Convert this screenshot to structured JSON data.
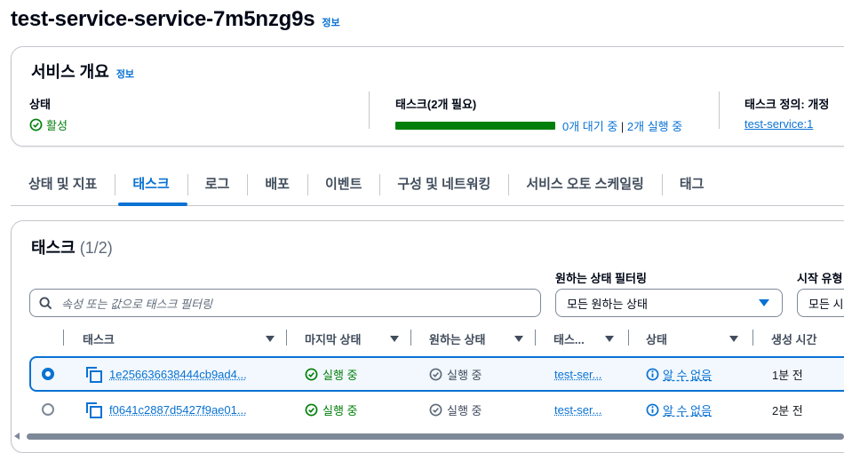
{
  "page": {
    "title": "test-service-service-7m5nzg9s",
    "info": "정보"
  },
  "overview": {
    "title": "서비스 개요",
    "info": "정보",
    "status_label": "상태",
    "status_value": "활성",
    "tasks_label": "태스크(2개 필요)",
    "pending": "0개 대기 중",
    "separator": " | ",
    "running": "2개 실행 중",
    "progress_fraction": 1.0,
    "taskdef_label": "태스크 정의: 개정",
    "taskdef_value": "test-service:1"
  },
  "tabs": [
    "상태 및 지표",
    "태스크",
    "로그",
    "배포",
    "이벤트",
    "구성 및 네트워킹",
    "서비스 오토 스케일링",
    "태그"
  ],
  "active_tab": "태스크",
  "tasks": {
    "title": "태스크",
    "count": "(1/2)",
    "desired_filter_label": "원하는 상태 필터링",
    "launch_type_label": "시작 유형",
    "search_placeholder": "속성 또는 값으로 태스크 필터링",
    "desired_select": "모든 원하는 상태",
    "launch_select": "모든 시",
    "columns": [
      "태스크",
      "마지막 상태",
      "원하는 상태",
      "태스...",
      "상태",
      "생성 시간"
    ],
    "rows": [
      {
        "selected": true,
        "task": "1e256636638444cb9ad4...",
        "last": "실행 중",
        "desired": "실행 중",
        "taskdef": "test-ser...",
        "health": "알 수 없음",
        "created": "1분 전"
      },
      {
        "selected": false,
        "task": "f0641c2887d5427f9ae01...",
        "last": "실행 중",
        "desired": "실행 중",
        "taskdef": "test-ser...",
        "health": "알 수 없음",
        "created": "2분 전"
      }
    ]
  },
  "colors": {
    "accent": "#0972d3",
    "success": "#037f0c",
    "border": "#c6c6cd"
  }
}
